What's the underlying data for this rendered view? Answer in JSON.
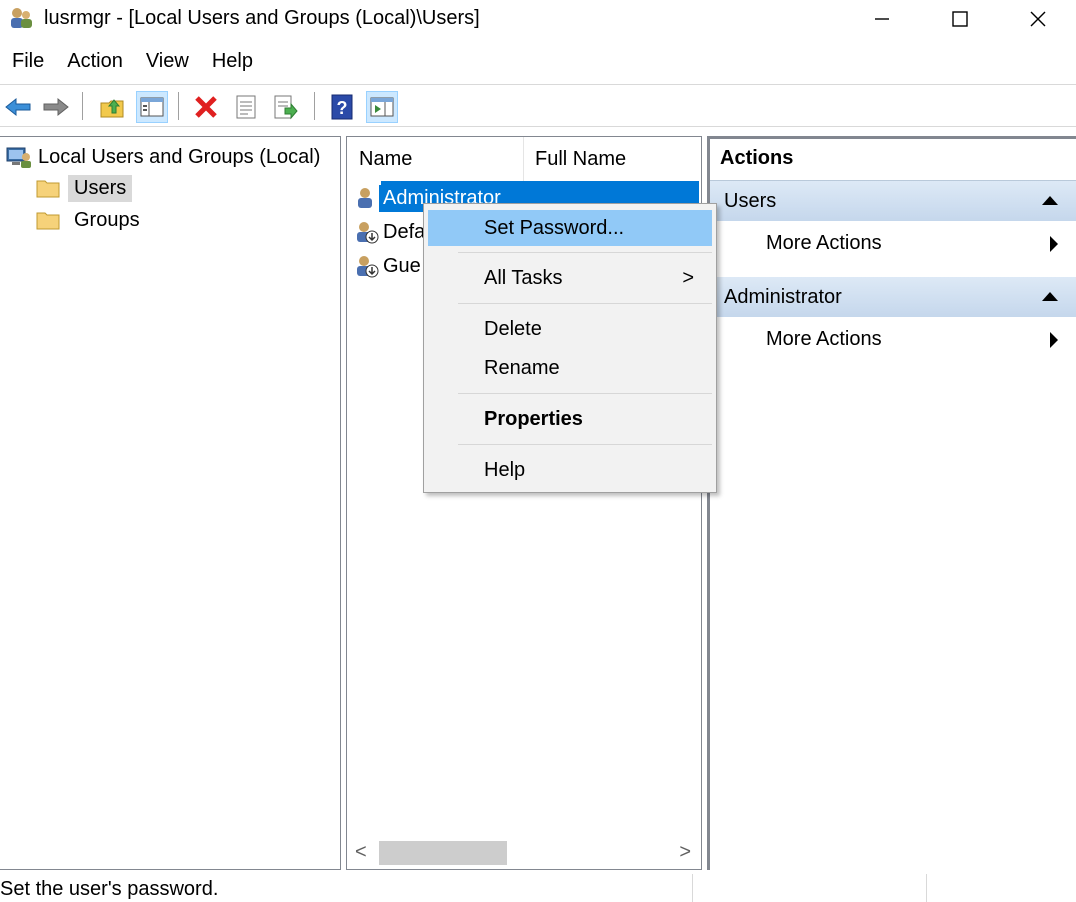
{
  "window": {
    "title": "lusrmgr - [Local Users and Groups (Local)\\Users]",
    "controls": {
      "minimize": "—",
      "maximize": "☐",
      "close": "✕"
    }
  },
  "menu": [
    "File",
    "Action",
    "View",
    "Help"
  ],
  "toolbar": {
    "icons": [
      "back-arrow-icon",
      "forward-arrow-icon",
      "up-folder-icon",
      "show-hide-tree-icon",
      "delete-icon",
      "properties-icon",
      "export-list-icon",
      "help-icon",
      "show-hide-action-pane-icon"
    ]
  },
  "tree": {
    "root": "Local Users and Groups (Local)",
    "items": [
      "Users",
      "Groups"
    ],
    "selected": "Users"
  },
  "list": {
    "columns": [
      "Name",
      "Full Name"
    ],
    "rows": [
      {
        "name": "Administrator",
        "selected": true
      },
      {
        "name": "Defa"
      },
      {
        "name": "Gue"
      }
    ],
    "scroll_left": "<",
    "scroll_right": ">"
  },
  "actions": {
    "header": "Actions",
    "sections": [
      {
        "title": "Users",
        "items": [
          "More Actions"
        ]
      },
      {
        "title": "Administrator",
        "items": [
          "More Actions"
        ]
      }
    ]
  },
  "context_menu": {
    "items": [
      "Set Password...",
      "All Tasks",
      "Delete",
      "Rename",
      "Properties",
      "Help"
    ],
    "highlighted": "Set Password...",
    "submenu_marker": ">"
  },
  "status": {
    "text": "Set the user's password."
  },
  "colors": {
    "selection": "#0078d7",
    "menu_highlight": "#91c9f7",
    "action_header": "#c5d7ec"
  }
}
